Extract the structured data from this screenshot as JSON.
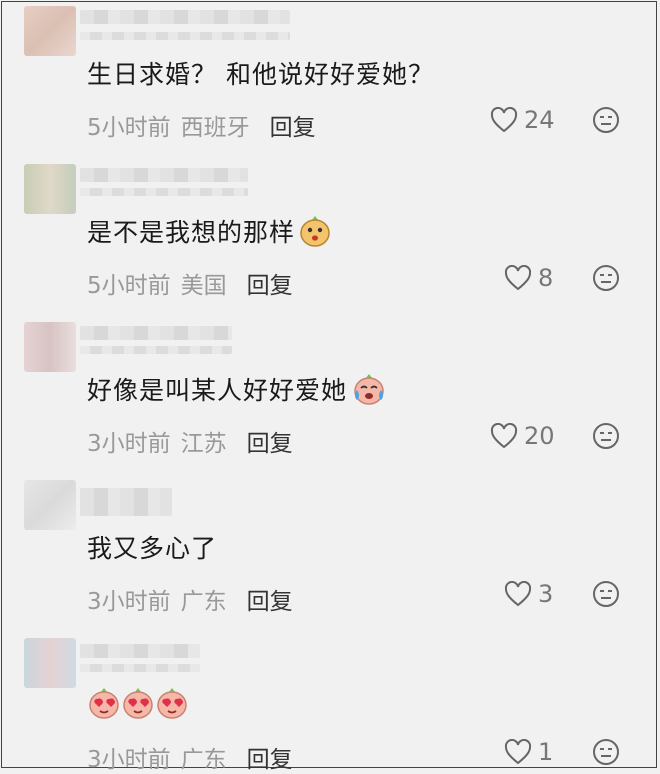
{
  "comments": [
    {
      "text": "生日求婚？ 和他说好好爱她？",
      "time": "5小时前",
      "region": "西班牙",
      "reply": "回复",
      "likes": "24",
      "emoji": []
    },
    {
      "text": "是不是我想的那样",
      "time": "5小时前",
      "region": "美国",
      "reply": "回复",
      "likes": "8",
      "emoji": [
        "drooling-face-icon"
      ]
    },
    {
      "text": "好像是叫某人好好爱她",
      "time": "3小时前",
      "region": "江苏",
      "reply": "回复",
      "likes": "20",
      "emoji": [
        "crying-face-icon"
      ]
    },
    {
      "text": "我又多心了",
      "time": "3小时前",
      "region": "广东",
      "reply": "回复",
      "likes": "3",
      "emoji": []
    },
    {
      "text": "",
      "time": "3小时前",
      "region": "广东",
      "reply": "回复",
      "likes": "1",
      "emoji": [
        "heart-eyes-icon",
        "heart-eyes-icon",
        "heart-eyes-icon"
      ]
    }
  ],
  "colors": {
    "background": "#f1f1f1",
    "text": "#1a1a1a",
    "meta": "#999999",
    "reply": "#333333"
  }
}
